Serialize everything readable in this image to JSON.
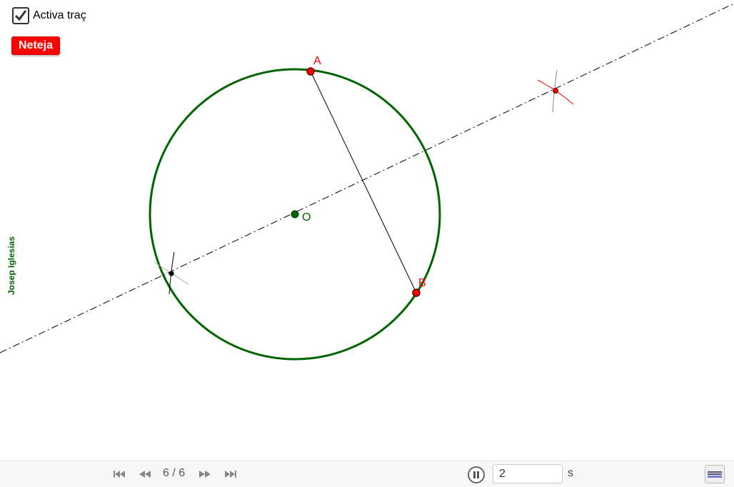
{
  "controls": {
    "trace_label": "Activa traç",
    "trace_checked": true,
    "clear_label": "Neteja"
  },
  "author": "Josep Iglesias",
  "points": {
    "center": "O",
    "a": "A",
    "b": "B"
  },
  "playback": {
    "step_text": "6 / 6",
    "speed_value": "2",
    "speed_unit": "s",
    "state": "playing"
  },
  "colors": {
    "circle": "#006400",
    "point": "#ff0000",
    "center": "#006400",
    "line": "#000000",
    "arc_marks": "#ff0000",
    "button": "#ff0000"
  },
  "icons": {
    "first": "skip-to-start-icon",
    "prev": "rewind-icon",
    "next": "fast-forward-icon",
    "last": "skip-to-end-icon",
    "pause": "pause-icon",
    "algebra": "algebra-view-icon"
  }
}
